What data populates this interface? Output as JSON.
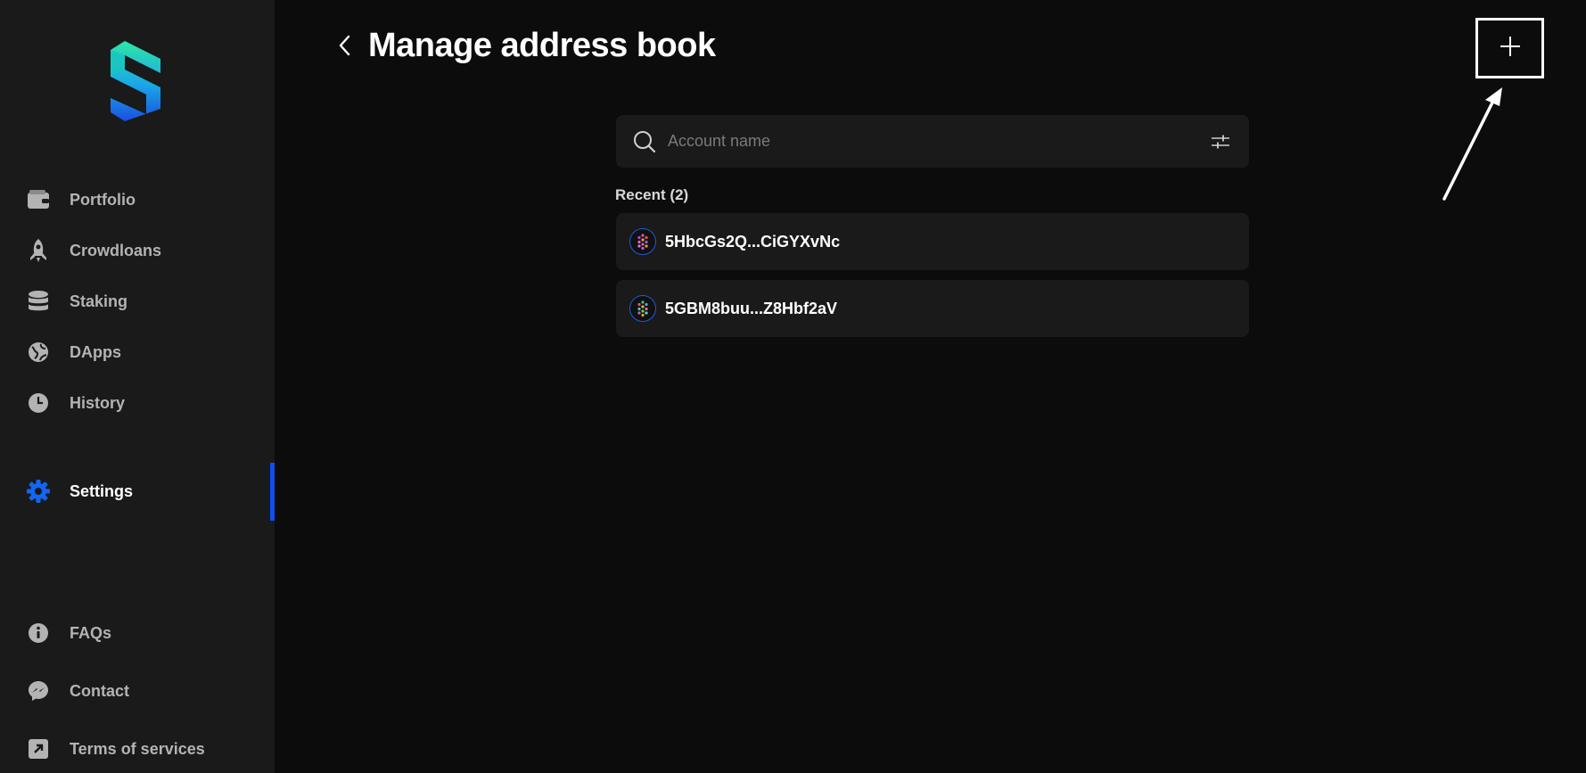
{
  "sidebar": {
    "brand": "S",
    "items": [
      {
        "label": "Portfolio",
        "icon": "wallet-icon"
      },
      {
        "label": "Crowdloans",
        "icon": "rocket-icon"
      },
      {
        "label": "Staking",
        "icon": "database-icon"
      },
      {
        "label": "DApps",
        "icon": "globe-icon"
      },
      {
        "label": "History",
        "icon": "clock-icon"
      },
      {
        "label": "Settings",
        "icon": "gear-icon",
        "active": true
      }
    ],
    "footer_items": [
      {
        "label": "FAQs",
        "icon": "info-icon"
      },
      {
        "label": "Contact",
        "icon": "messenger-icon"
      },
      {
        "label": "Terms of services",
        "icon": "external-link-icon"
      }
    ]
  },
  "header": {
    "title": "Manage address book",
    "back_icon": "chevron-left-icon",
    "add_icon": "plus-icon"
  },
  "search": {
    "placeholder": "Account name",
    "value": ""
  },
  "recent": {
    "label": "Recent (2)",
    "accounts": [
      {
        "address": "5HbcGs2Q...CiGYXvNc"
      },
      {
        "address": "5GBM8buu...Z8Hbf2aV"
      }
    ]
  },
  "colors": {
    "background": "#0c0c0c",
    "sidebar": "#1a1a1a",
    "accent": "#0d4ff0",
    "row": "#1a1a1a"
  }
}
